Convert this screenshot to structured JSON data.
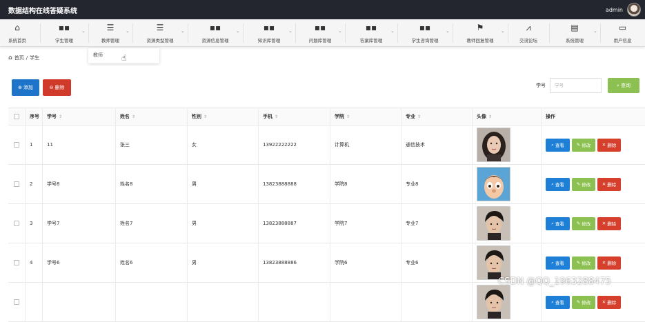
{
  "app": {
    "title": "数据结构在线答疑系统",
    "user": "admin"
  },
  "nav": {
    "items": [
      {
        "label": "系统首页",
        "icon": "home-icon",
        "glyph": "⌂"
      },
      {
        "label": "学生管理",
        "icon": "grid-icon",
        "glyph": "▪▪"
      },
      {
        "label": "教师管理",
        "icon": "list-icon",
        "glyph": "☰"
      },
      {
        "label": "资源类型管理",
        "icon": "list-icon",
        "glyph": "☰"
      },
      {
        "label": "资源信息管理",
        "icon": "grid-icon",
        "glyph": "▪▪"
      },
      {
        "label": "知识库管理",
        "icon": "grid-icon",
        "glyph": "▪▪"
      },
      {
        "label": "问题库管理",
        "icon": "grid-icon",
        "glyph": "▪▪"
      },
      {
        "label": "答案库管理",
        "icon": "grid-icon",
        "glyph": "▪▪"
      },
      {
        "label": "学生咨询管理",
        "icon": "grid-icon",
        "glyph": "▪▪"
      },
      {
        "label": "教师回复管理",
        "icon": "flag-icon",
        "glyph": "⚑"
      },
      {
        "label": "交流论坛",
        "icon": "chart-icon",
        "glyph": "⩘"
      },
      {
        "label": "系统管理",
        "icon": "clipboard-icon",
        "glyph": "▤"
      },
      {
        "label": "用户信息",
        "icon": "card-icon",
        "glyph": "▭"
      }
    ],
    "dropdown_item": "教师"
  },
  "breadcrumb": {
    "home": "首页",
    "sep": "/",
    "current": "学生"
  },
  "toolbar": {
    "add_label": "添加",
    "delete_label": "删除",
    "search_label": "学号",
    "search_placeholder": "学号",
    "search_button": "查询"
  },
  "table": {
    "columns": [
      "序号",
      "学号",
      "姓名",
      "性别",
      "手机",
      "学院",
      "专业",
      "头像",
      "操作"
    ],
    "actions": {
      "view": "查看",
      "edit": "修改",
      "delete": "删除"
    },
    "rows": [
      {
        "no": "1",
        "student_id": "11",
        "name": "张三",
        "gender": "女",
        "phone": "13922222222",
        "college": "计算机",
        "major": "通信技术",
        "avatar": "avatar-woman"
      },
      {
        "no": "2",
        "student_id": "学号8",
        "name": "姓名8",
        "gender": "男",
        "phone": "13823888888",
        "college": "学院8",
        "major": "专业8",
        "avatar": "avatar-cartoon"
      },
      {
        "no": "3",
        "student_id": "学号7",
        "name": "姓名7",
        "gender": "男",
        "phone": "13823888887",
        "college": "学院7",
        "major": "专业7",
        "avatar": "avatar-man"
      },
      {
        "no": "4",
        "student_id": "学号6",
        "name": "姓名6",
        "gender": "男",
        "phone": "13823888886",
        "college": "学院6",
        "major": "专业6",
        "avatar": "avatar-man"
      },
      {
        "no": "",
        "student_id": "",
        "name": "",
        "gender": "",
        "phone": "",
        "college": "",
        "major": "",
        "avatar": "avatar-man"
      }
    ]
  },
  "watermark": "CSDN @QQ_1963288475",
  "colors": {
    "topbar": "#23262e",
    "primary": "#1e74c8",
    "danger": "#cf3a2a",
    "success": "#8cc152"
  }
}
